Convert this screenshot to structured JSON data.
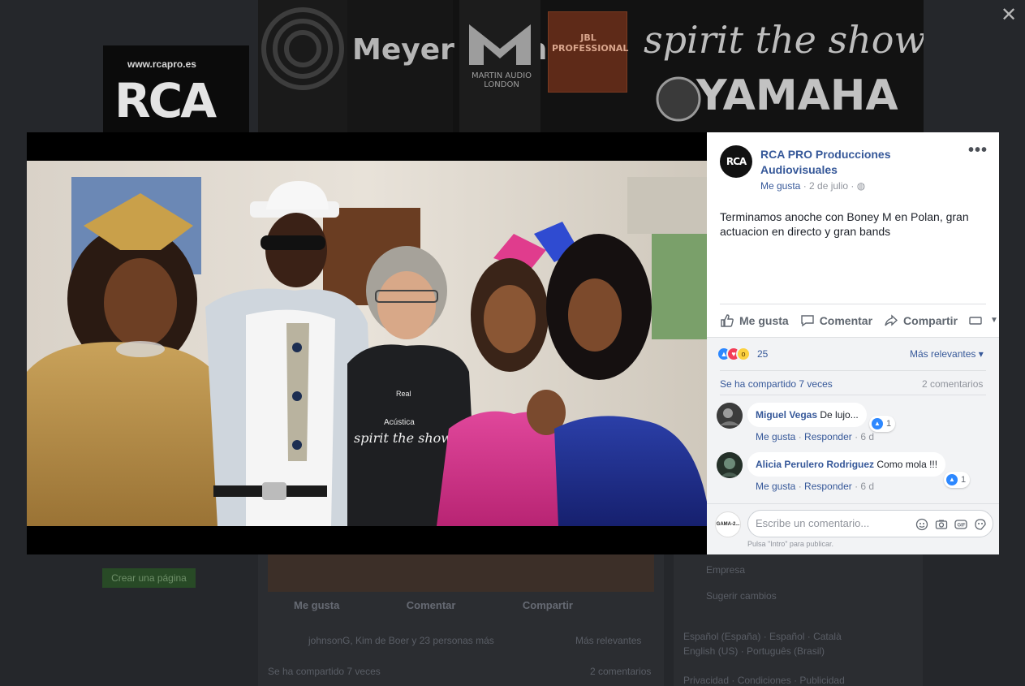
{
  "background": {
    "logo_url": "www.rcapro.es",
    "logo_text": "RCA",
    "cover_brands": [
      "Meyer Sound",
      "MARTIN AUDIO LONDON",
      "JBL PROFESSIONAL",
      "spirit the show",
      "YAMAHA"
    ],
    "create_page": "Crear una página",
    "actions": {
      "like": "Me gusta",
      "comment": "Comentar",
      "share": "Compartir"
    },
    "reactions_text": "johnsonG, Kim de Boer y 23 personas más",
    "relevant": "Más relevantes",
    "shared": "Se ha compartido 7 veces",
    "comments": "2 comentarios",
    "sidebar": {
      "company": "Empresa",
      "suggest": "Sugerir cambios",
      "languages": "Español (España) · Español · Català",
      "languages2": "English (US) · Português (Brasil)",
      "footer": "Privacidad · Condiciones · Publicidad"
    }
  },
  "lightbox": {
    "close_icon": "close-icon",
    "photo_shirt_text": [
      "Real",
      "Acústica",
      "spirit the show"
    ]
  },
  "post": {
    "author": "RCA PRO Producciones Audiovisuales",
    "avatar_text": "RCA",
    "like_link": "Me gusta",
    "date": "2 de julio",
    "separator": " · ",
    "text": "Terminamos anoche con Boney M en Polan, gran actuacion en directo y gran bands",
    "actions": {
      "like": "Me gusta",
      "comment": "Comentar",
      "share": "Compartir"
    },
    "reactions": {
      "count": "25",
      "relevant": "Más relevantes ▾"
    },
    "shared": "Se ha compartido 7 veces",
    "comments_count": "2 comentarios",
    "comments": [
      {
        "name": "Miguel Vegas",
        "text": "De lujo...",
        "likes": "1",
        "like": "Me gusta",
        "reply": "Responder",
        "ago": "6 d"
      },
      {
        "name": "Alicia Perulero Rodriguez",
        "text": "Como mola !!!",
        "likes": "1",
        "like": "Me gusta",
        "reply": "Responder",
        "ago": "6 d"
      }
    ],
    "writer_avatar": "GAMA-2...",
    "write_placeholder": "Escribe un comentario...",
    "hint": "Pulsa \"Intro\" para publicar."
  },
  "colors": {
    "link": "#365899",
    "like_blue": "#2d88ff",
    "love_red": "#f33e58",
    "wow_yellow": "#fcd13f"
  }
}
